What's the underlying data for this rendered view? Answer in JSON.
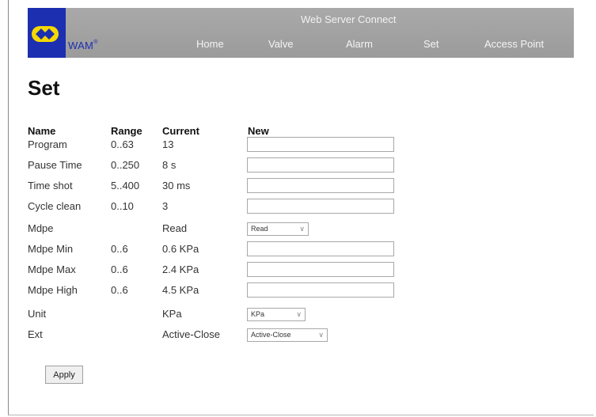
{
  "header": {
    "title": "Web Server Connect",
    "logo_text": "WAM",
    "logo_reg": "®",
    "nav": [
      "Home",
      "Valve",
      "Alarm",
      "Set",
      "Access Point"
    ]
  },
  "page_title": "Set",
  "columns": {
    "name": "Name",
    "range": "Range",
    "current": "Current",
    "new": "New"
  },
  "rows": [
    {
      "name": "Program",
      "range": "0..63",
      "current": "13",
      "new": "",
      "type": "text"
    },
    {
      "name": "Pause Time",
      "range": "0..250",
      "current": "8 s",
      "new": "",
      "type": "text"
    },
    {
      "name": "Time shot",
      "range": "5..400",
      "current": "30 ms",
      "new": "",
      "type": "text"
    },
    {
      "name": "Cycle clean",
      "range": "0..10",
      "current": "3",
      "new": "",
      "type": "text"
    },
    {
      "name": "Mdpe",
      "range": "",
      "current": "Read",
      "new": "Read",
      "type": "select"
    },
    {
      "name": "Mdpe Min",
      "range": "0..6",
      "current": "0.6 KPa",
      "new": "",
      "type": "text"
    },
    {
      "name": "Mdpe Max",
      "range": "0..6",
      "current": "2.4 KPa",
      "new": "",
      "type": "text"
    },
    {
      "name": "Mdpe High",
      "range": "0..6",
      "current": "4.5 KPa",
      "new": "",
      "type": "text"
    },
    {
      "name": "Unit",
      "range": "",
      "current": "KPa",
      "new": "KPa",
      "type": "select"
    },
    {
      "name": "Ext",
      "range": "",
      "current": "Active-Close",
      "new": "Active-Close",
      "type": "select"
    }
  ],
  "apply_label": "Apply",
  "colors": {
    "header_bg": "#a3a3a3",
    "logo_blue": "#1b2fb0",
    "logo_yellow": "#f5d800"
  }
}
